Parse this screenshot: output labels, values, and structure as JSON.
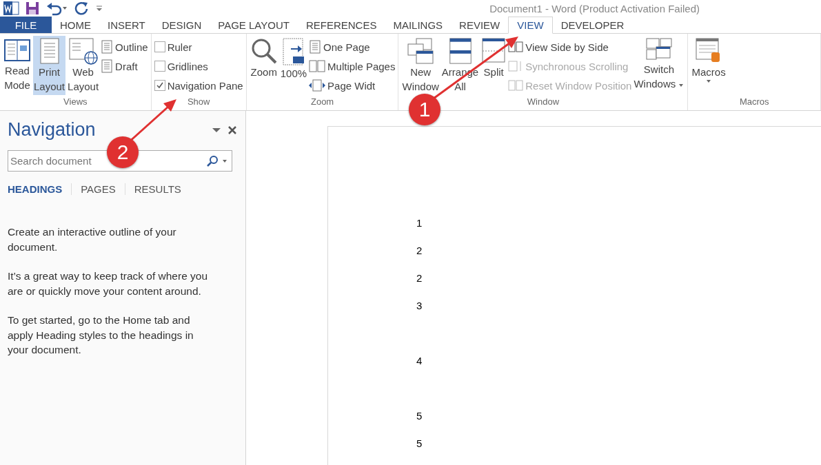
{
  "title_bar": {
    "title": "Document1 - Word (Product Activation Failed)"
  },
  "menu_tabs": [
    {
      "label": "FILE",
      "kind": "file",
      "selected": false
    },
    {
      "label": "HOME",
      "kind": "tab",
      "selected": false
    },
    {
      "label": "INSERT",
      "kind": "tab",
      "selected": false
    },
    {
      "label": "DESIGN",
      "kind": "tab",
      "selected": false
    },
    {
      "label": "PAGE LAYOUT",
      "kind": "tab",
      "selected": false
    },
    {
      "label": "REFERENCES",
      "kind": "tab",
      "selected": false
    },
    {
      "label": "MAILINGS",
      "kind": "tab",
      "selected": false
    },
    {
      "label": "REVIEW",
      "kind": "tab",
      "selected": false
    },
    {
      "label": "VIEW",
      "kind": "tab",
      "selected": true
    },
    {
      "label": "DEVELOPER",
      "kind": "tab",
      "selected": false
    }
  ],
  "ribbon": {
    "groups": [
      {
        "label": "Views",
        "columns": [
          {
            "kind": "large",
            "lines": [
              "Read",
              "Mode"
            ],
            "selected": false,
            "caret": false
          },
          {
            "kind": "large",
            "lines": [
              "Print",
              "Layout"
            ],
            "selected": true,
            "caret": false
          },
          {
            "kind": "large",
            "lines": [
              "Web",
              "Layout"
            ],
            "selected": false,
            "caret": false
          },
          {
            "kind": "stack",
            "items": [
              {
                "kind": "small",
                "label": "Outline",
                "disabled": false
              },
              {
                "kind": "small",
                "label": "Draft",
                "disabled": false
              }
            ]
          }
        ]
      },
      {
        "label": "Show",
        "columns": [
          {
            "kind": "stack",
            "items": [
              {
                "kind": "check",
                "label": "Ruler",
                "checked": false
              },
              {
                "kind": "check",
                "label": "Gridlines",
                "checked": false
              },
              {
                "kind": "check",
                "label": "Navigation Pane",
                "checked": true
              }
            ]
          }
        ]
      },
      {
        "label": "Zoom",
        "columns": [
          {
            "kind": "large",
            "lines": [
              "Zoom"
            ],
            "selected": false,
            "caret": false
          },
          {
            "kind": "large",
            "lines": [
              "100%"
            ],
            "selected": false,
            "caret": false
          },
          {
            "kind": "stack",
            "items": [
              {
                "kind": "small",
                "label": "One Page",
                "disabled": false
              },
              {
                "kind": "small",
                "label": "Multiple Pages",
                "disabled": false
              },
              {
                "kind": "small",
                "label": "Page Widt",
                "disabled": false
              }
            ]
          }
        ]
      },
      {
        "label": "Window",
        "columns": [
          {
            "kind": "large",
            "lines": [
              "New",
              "Window"
            ],
            "selected": false,
            "caret": false
          },
          {
            "kind": "large",
            "lines": [
              "Arrange",
              "All"
            ],
            "selected": false,
            "caret": false
          },
          {
            "kind": "large",
            "lines": [
              "Split"
            ],
            "selected": false,
            "caret": false
          },
          {
            "kind": "stack",
            "items": [
              {
                "kind": "small",
                "label": "View Side by Side",
                "disabled": false
              },
              {
                "kind": "small",
                "label": "Synchronous Scrolling",
                "disabled": true
              },
              {
                "kind": "small",
                "label": "Reset Window Position",
                "disabled": true
              }
            ]
          },
          {
            "kind": "large",
            "lines": [
              "Switch",
              "Windows"
            ],
            "selected": false,
            "caret": true
          }
        ]
      },
      {
        "label": "Macros",
        "columns": [
          {
            "kind": "large",
            "lines": [
              "Macros"
            ],
            "selected": false,
            "caret": true
          }
        ]
      }
    ]
  },
  "navigation": {
    "title": "Navigation",
    "search_placeholder": "Search document",
    "tabs": [
      {
        "label": "HEADINGS",
        "selected": true
      },
      {
        "label": "PAGES",
        "selected": false
      },
      {
        "label": "RESULTS",
        "selected": false
      }
    ],
    "paragraphs": [
      "Create an interactive outline of your document.",
      "It’s a great way to keep track of where you are or quickly move your content around.",
      "To get started, go to the Home tab and apply Heading styles to the headings in your document."
    ]
  },
  "document": {
    "blocks": [
      [
        "1",
        "2",
        "2",
        "3"
      ],
      [
        "4"
      ],
      [
        "5",
        "5"
      ]
    ]
  },
  "annotations": [
    {
      "label": "1"
    },
    {
      "label": "2"
    }
  ]
}
